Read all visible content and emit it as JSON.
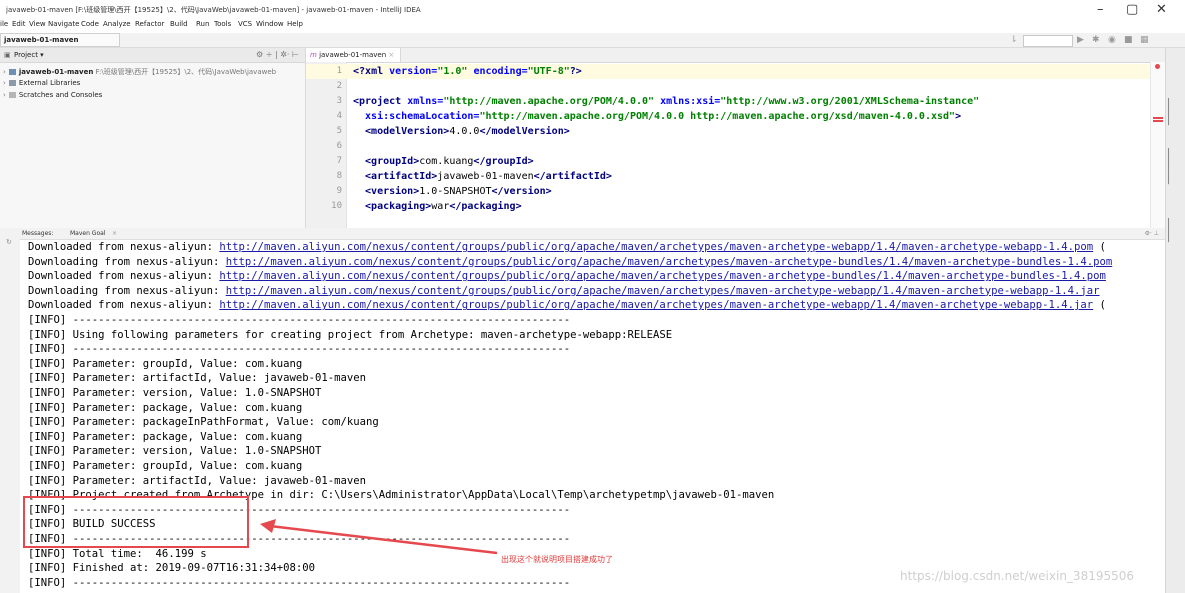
{
  "window": {
    "title": "javaweb-01-maven [F:\\班级管理\\西开【19525】\\2、代码\\JavaWeb\\javaweb-01-maven] - javaweb-01-maven - IntelliJ IDEA",
    "minimize": "–",
    "maximize": "▢",
    "close": "✕"
  },
  "menu": [
    "ile",
    "Edit",
    "View",
    "Navigate",
    "Code",
    "Analyze",
    "Refactor",
    "Build",
    "Run",
    "Tools",
    "VCS",
    "Window",
    "Help"
  ],
  "breadcrumb": "javaweb-01-maven",
  "project": {
    "title": "Project",
    "items": [
      {
        "name": "javaweb-01-maven",
        "path": "F:\\班级管理\\西开【19525】\\2、代码\\JavaWeb\\javaweb"
      },
      {
        "name": "External Libraries"
      },
      {
        "name": "Scratches and Consoles"
      }
    ]
  },
  "editor": {
    "tab": "javaweb-01-maven",
    "lines": [
      {
        "n": "1",
        "segs": [
          {
            "t": "<?",
            "c": "tag"
          },
          {
            "t": "xml ",
            "c": "tag"
          },
          {
            "t": "version=",
            "c": "attr"
          },
          {
            "t": "\"1.0\" ",
            "c": "val"
          },
          {
            "t": "encoding=",
            "c": "attr"
          },
          {
            "t": "\"UTF-8\"",
            "c": "val"
          },
          {
            "t": "?>",
            "c": "tag"
          }
        ]
      },
      {
        "n": "2",
        "segs": []
      },
      {
        "n": "3",
        "segs": [
          {
            "t": "<project ",
            "c": "tag"
          },
          {
            "t": "xmlns=",
            "c": "attr"
          },
          {
            "t": "\"http://maven.apache.org/POM/4.0.0\" ",
            "c": "val"
          },
          {
            "t": "xmlns:xsi=",
            "c": "attr"
          },
          {
            "t": "\"http://www.w3.org/2001/XMLSchema-instance\"",
            "c": "val"
          }
        ]
      },
      {
        "n": "4",
        "segs": [
          {
            "t": "  xsi:schemaLocation=",
            "c": "attr"
          },
          {
            "t": "\"http://maven.apache.org/POM/4.0.0 http://maven.apache.org/xsd/maven-4.0.0.xsd\"",
            "c": "val"
          },
          {
            "t": ">",
            "c": "tag"
          }
        ]
      },
      {
        "n": "5",
        "segs": [
          {
            "t": "  <modelVersion>",
            "c": "tag"
          },
          {
            "t": "4.0.0",
            "c": "txt"
          },
          {
            "t": "</modelVersion>",
            "c": "tag"
          }
        ]
      },
      {
        "n": "6",
        "segs": []
      },
      {
        "n": "7",
        "segs": [
          {
            "t": "  <groupId>",
            "c": "tag"
          },
          {
            "t": "com.kuang",
            "c": "txt"
          },
          {
            "t": "</groupId>",
            "c": "tag"
          }
        ]
      },
      {
        "n": "8",
        "segs": [
          {
            "t": "  <artifactId>",
            "c": "tag"
          },
          {
            "t": "javaweb-01-maven",
            "c": "txt"
          },
          {
            "t": "</artifactId>",
            "c": "tag"
          }
        ]
      },
      {
        "n": "9",
        "segs": [
          {
            "t": "  <version>",
            "c": "tag"
          },
          {
            "t": "1.0-SNAPSHOT",
            "c": "txt"
          },
          {
            "t": "</version>",
            "c": "tag"
          }
        ]
      },
      {
        "n": "10",
        "segs": [
          {
            "t": "  <packaging>",
            "c": "tag"
          },
          {
            "t": "war",
            "c": "txt"
          },
          {
            "t": "</packaging>",
            "c": "tag"
          }
        ]
      }
    ]
  },
  "messages": {
    "tabs": [
      "Messages:",
      "Maven Goal",
      "×"
    ],
    "lines": [
      {
        "prefix": "Downloaded from nexus-aliyun: ",
        "link": "http://maven.aliyun.com/nexus/content/groups/public/org/apache/maven/archetypes/maven-archetype-webapp/1.4/maven-archetype-webapp-1.4.pom",
        "suffix": " ("
      },
      {
        "prefix": "Downloading from nexus-aliyun: ",
        "link": "http://maven.aliyun.com/nexus/content/groups/public/org/apache/maven/archetypes/maven-archetype-bundles/1.4/maven-archetype-bundles-1.4.pom",
        "suffix": ""
      },
      {
        "prefix": "Downloaded from nexus-aliyun: ",
        "link": "http://maven.aliyun.com/nexus/content/groups/public/org/apache/maven/archetypes/maven-archetype-bundles/1.4/maven-archetype-bundles-1.4.pom",
        "suffix": ""
      },
      {
        "prefix": "Downloading from nexus-aliyun: ",
        "link": "http://maven.aliyun.com/nexus/content/groups/public/org/apache/maven/archetypes/maven-archetype-webapp/1.4/maven-archetype-webapp-1.4.jar",
        "suffix": ""
      },
      {
        "prefix": "Downloaded from nexus-aliyun: ",
        "link": "http://maven.aliyun.com/nexus/content/groups/public/org/apache/maven/archetypes/maven-archetype-webapp/1.4/maven-archetype-webapp-1.4.jar",
        "suffix": " ("
      },
      {
        "prefix": "[INFO] ------------------------------------------------------------------------------"
      },
      {
        "prefix": "[INFO] Using following parameters for creating project from Archetype: maven-archetype-webapp:RELEASE"
      },
      {
        "prefix": "[INFO] ------------------------------------------------------------------------------"
      },
      {
        "prefix": "[INFO] Parameter: groupId, Value: com.kuang"
      },
      {
        "prefix": "[INFO] Parameter: artifactId, Value: javaweb-01-maven"
      },
      {
        "prefix": "[INFO] Parameter: version, Value: 1.0-SNAPSHOT"
      },
      {
        "prefix": "[INFO] Parameter: package, Value: com.kuang"
      },
      {
        "prefix": "[INFO] Parameter: packageInPathFormat, Value: com/kuang"
      },
      {
        "prefix": "[INFO] Parameter: package, Value: com.kuang"
      },
      {
        "prefix": "[INFO] Parameter: version, Value: 1.0-SNAPSHOT"
      },
      {
        "prefix": "[INFO] Parameter: groupId, Value: com.kuang"
      },
      {
        "prefix": "[INFO] Parameter: artifactId, Value: javaweb-01-maven"
      },
      {
        "prefix": "[INFO] Project created from Archetype in dir: C:\\Users\\Administrator\\AppData\\Local\\Temp\\archetypetmp\\javaweb-01-maven"
      },
      {
        "prefix": "[INFO] ------------------------------------------------------------------------------"
      },
      {
        "prefix": "[INFO] BUILD SUCCESS"
      },
      {
        "prefix": "[INFO] ------------------------------------------------------------------------------"
      },
      {
        "prefix": "[INFO] Total time:  46.199 s"
      },
      {
        "prefix": "[INFO] Finished at: 2019-09-07T16:31:34+08:00"
      },
      {
        "prefix": "[INFO] ------------------------------------------------------------------------------"
      }
    ]
  },
  "annotation": {
    "text": "出现这个就说明项目搭建成功了",
    "color": "#e5484d"
  },
  "watermark": "https://blog.csdn.net/weixin_38195506",
  "colors": {
    "xml_tag": "#000080",
    "xml_attr": "#0000ff",
    "xml_value": "#008000",
    "link": "#1a1aa6"
  }
}
